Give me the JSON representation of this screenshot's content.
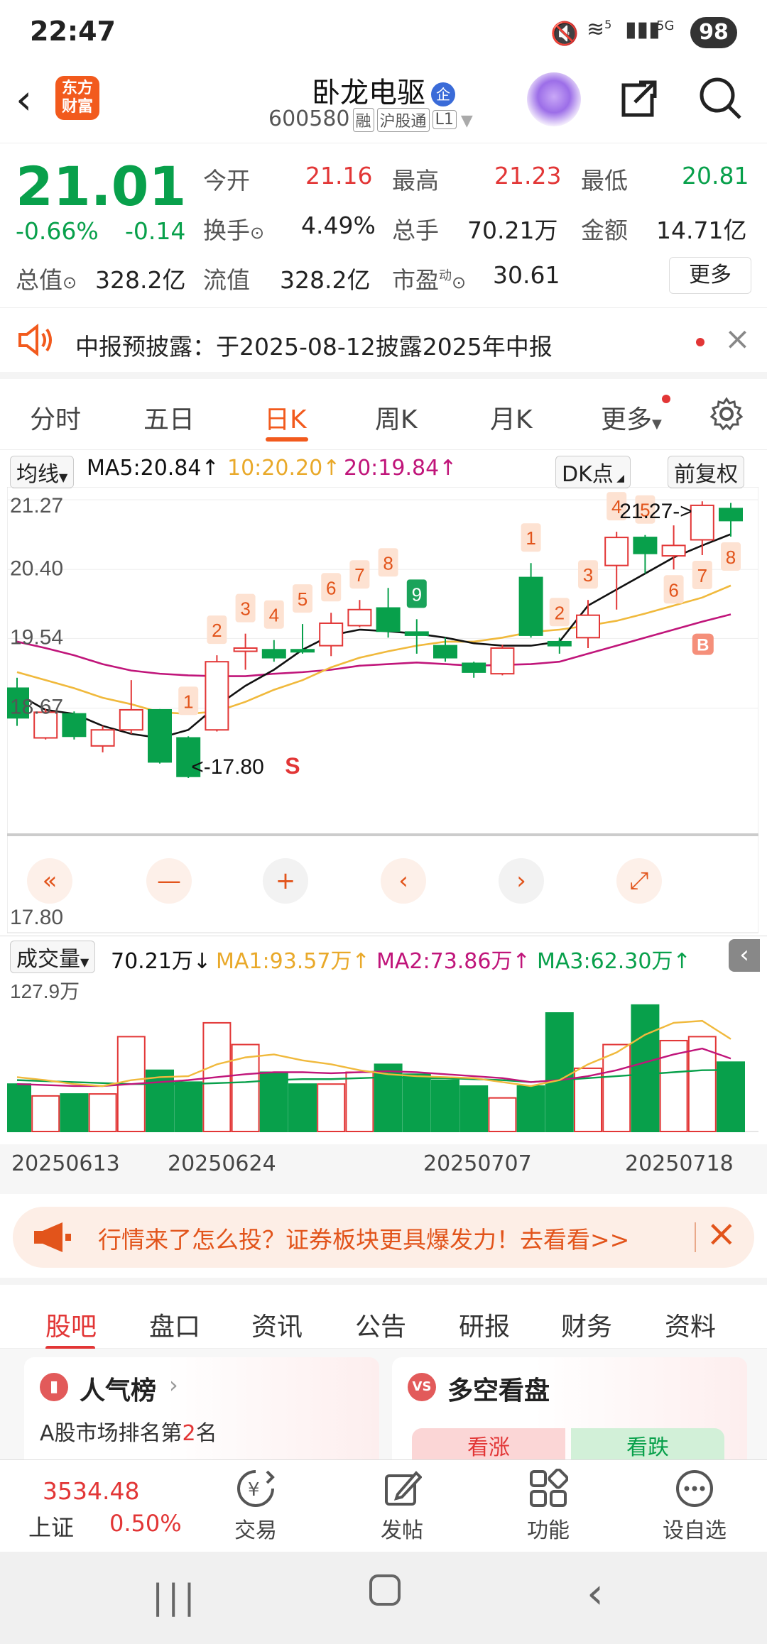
{
  "status": {
    "time": "22:47",
    "battery": "98",
    "net1": "5",
    "net2": "5G"
  },
  "header": {
    "title": "卧龙电驱",
    "badge": "企",
    "code": "600580",
    "tags": [
      "融",
      "沪股通",
      "L1"
    ],
    "logo_text": "东方\n财富"
  },
  "quote": {
    "price": "21.01",
    "change_pct": "-0.66%",
    "change": "-0.14",
    "open_label": "今开",
    "open": "21.16",
    "high_label": "最高",
    "high": "21.23",
    "low_label": "最低",
    "low": "20.81",
    "turnover_label": "换手",
    "turnover": "4.49%",
    "volume_label": "总手",
    "volume": "70.21万",
    "amount_label": "金额",
    "amount": "14.71亿",
    "mcap_label": "总值",
    "mcap": "328.2亿",
    "float_label": "流值",
    "float": "328.2亿",
    "pe_label": "市盈",
    "pe_sup": "动",
    "pe": "30.61",
    "more": "更多"
  },
  "notice": {
    "text": "中报预披露：于2025-08-12披露2025年中报"
  },
  "tabs": [
    "分时",
    "五日",
    "日K",
    "周K",
    "月K",
    "更多"
  ],
  "chart_header": {
    "ma_select": "均线",
    "ma5": "MA5:20.84↑",
    "ma10": "10:20.20↑",
    "ma20": "20:19.84↑",
    "dk": "DK点",
    "adjust": "前复权"
  },
  "chart_labels": {
    "y_top": "21.27",
    "y2": "20.40",
    "y3": "19.54",
    "y4": "18.67",
    "y_bottom": "17.80",
    "max_label": "21.27->",
    "min_label": "<-17.80",
    "sell": "S",
    "buy": "B"
  },
  "vol_header": {
    "select": "成交量",
    "vol": "70.21万↓",
    "ma1": "MA1:93.57万↑",
    "ma2": "MA2:73.86万↑",
    "ma3": "MA3:62.30万↑",
    "top": "127.9万"
  },
  "dates": [
    "20250613",
    "20250624",
    "20250707",
    "20250718"
  ],
  "banner": {
    "text": "行情来了怎么投？证券板块更具爆发力！去看看>>"
  },
  "feed_tabs": [
    "股吧",
    "盘口",
    "资讯",
    "公告",
    "研报",
    "财务",
    "资料"
  ],
  "cards": {
    "left_title": "人气榜",
    "left_sub_pre": "A股市场排名第",
    "left_sub_num": "2",
    "left_sub_post": "名",
    "right_title": "多空看盘",
    "up": "看涨",
    "down": "看跌"
  },
  "bottom_nav": {
    "index_value": "3534.48",
    "index_name": "上证",
    "index_change": "0.50%",
    "items": [
      "交易",
      "发帖",
      "功能",
      "设自选"
    ]
  },
  "colors": {
    "up": "#e23636",
    "down": "#08a04b",
    "accent": "#f25a1d",
    "ma5": "#111111",
    "ma10": "#f0b93c",
    "ma20": "#c0157a"
  },
  "chart_data": {
    "type": "candlestick",
    "ylim": [
      17.8,
      21.27
    ],
    "candles": [
      {
        "o": 18.92,
        "c": 18.55,
        "h": 19.05,
        "l": 18.45
      },
      {
        "o": 18.3,
        "c": 18.62,
        "h": 18.66,
        "l": 18.28
      },
      {
        "o": 18.6,
        "c": 18.32,
        "h": 18.63,
        "l": 18.28
      },
      {
        "o": 18.2,
        "c": 18.4,
        "h": 18.45,
        "l": 18.12
      },
      {
        "o": 18.4,
        "c": 18.65,
        "h": 19.02,
        "l": 18.35
      },
      {
        "o": 18.65,
        "c": 18.0,
        "h": 18.66,
        "l": 17.98
      },
      {
        "o": 18.3,
        "c": 17.82,
        "h": 18.32,
        "l": 17.8
      },
      {
        "o": 18.4,
        "c": 19.25,
        "h": 19.33,
        "l": 18.38
      },
      {
        "o": 19.38,
        "c": 19.42,
        "h": 19.6,
        "l": 19.15
      },
      {
        "o": 19.4,
        "c": 19.3,
        "h": 19.52,
        "l": 19.25
      },
      {
        "o": 19.4,
        "c": 19.38,
        "h": 19.72,
        "l": 19.35
      },
      {
        "o": 19.45,
        "c": 19.73,
        "h": 19.86,
        "l": 19.32
      },
      {
        "o": 19.7,
        "c": 19.9,
        "h": 20.02,
        "l": 19.68
      },
      {
        "o": 19.92,
        "c": 19.63,
        "h": 20.17,
        "l": 19.55
      },
      {
        "o": 19.62,
        "c": 19.58,
        "h": 19.78,
        "l": 19.35
      },
      {
        "o": 19.45,
        "c": 19.3,
        "h": 19.55,
        "l": 19.25
      },
      {
        "o": 19.23,
        "c": 19.12,
        "h": 19.25,
        "l": 19.05
      },
      {
        "o": 19.1,
        "c": 19.42,
        "h": 19.46,
        "l": 19.08
      },
      {
        "o": 20.3,
        "c": 19.58,
        "h": 20.48,
        "l": 19.55
      },
      {
        "o": 19.5,
        "c": 19.45,
        "h": 19.55,
        "l": 19.35
      },
      {
        "o": 19.55,
        "c": 19.83,
        "h": 20.02,
        "l": 19.42
      },
      {
        "o": 20.45,
        "c": 20.8,
        "h": 20.87,
        "l": 19.9
      },
      {
        "o": 20.8,
        "c": 20.6,
        "h": 20.83,
        "l": 20.35
      },
      {
        "o": 20.57,
        "c": 20.7,
        "h": 20.95,
        "l": 20.4
      },
      {
        "o": 20.77,
        "c": 21.2,
        "h": 21.25,
        "l": 20.58
      },
      {
        "o": 21.16,
        "c": 21.01,
        "h": 21.23,
        "l": 20.81
      }
    ],
    "ma5": [
      18.85,
      18.65,
      18.6,
      18.45,
      18.35,
      18.3,
      18.4,
      18.7,
      18.95,
      19.15,
      19.4,
      19.58,
      19.65,
      19.63,
      19.6,
      19.55,
      19.48,
      19.45,
      19.45,
      19.5,
      19.95,
      20.15,
      20.35,
      20.55,
      20.7,
      20.84
    ],
    "ma10": [
      19.12,
      19.02,
      18.92,
      18.8,
      18.72,
      18.62,
      18.6,
      18.63,
      18.75,
      18.9,
      19.02,
      19.18,
      19.3,
      19.38,
      19.45,
      19.5,
      19.5,
      19.55,
      19.62,
      19.65,
      19.7,
      19.76,
      19.85,
      19.95,
      20.05,
      20.2
    ],
    "ma20": [
      19.5,
      19.42,
      19.33,
      19.22,
      19.14,
      19.1,
      19.08,
      19.07,
      19.07,
      19.1,
      19.12,
      19.15,
      19.2,
      19.22,
      19.24,
      19.22,
      19.2,
      19.21,
      19.22,
      19.25,
      19.35,
      19.45,
      19.55,
      19.65,
      19.75,
      19.84
    ],
    "volume": [
      48,
      36,
      38,
      38,
      96,
      62,
      50,
      110,
      88,
      60,
      48,
      48,
      60,
      68,
      58,
      52,
      46,
      34,
      46,
      120,
      64,
      88,
      128,
      92,
      96,
      70.21
    ],
    "vol_ma1": [
      55,
      52,
      48,
      46,
      52,
      55,
      56,
      68,
      75,
      78,
      72,
      68,
      62,
      58,
      56,
      55,
      54,
      50,
      46,
      52,
      68,
      80,
      98,
      110,
      112,
      93.57
    ],
    "vol_ma2": [
      48,
      47,
      46,
      46,
      48,
      50,
      52,
      55,
      58,
      60,
      60,
      59,
      60,
      61,
      60,
      58,
      56,
      54,
      50,
      52,
      56,
      62,
      70,
      78,
      84,
      73.86
    ],
    "vol_ma3": [
      52,
      51,
      50,
      49,
      48,
      48,
      48,
      49,
      50,
      52,
      53,
      53,
      54,
      55,
      54,
      54,
      53,
      52,
      50,
      52,
      54,
      56,
      58,
      60,
      62,
      62.3
    ],
    "vol_ylim": [
      0,
      127.9
    ],
    "candle_numbers": [
      "1",
      "2",
      "3",
      "4",
      "5",
      "6",
      "7",
      "8",
      "9",
      "1",
      "2",
      "3",
      "4",
      "5",
      "6",
      "7",
      "8"
    ],
    "x_dates": [
      "20250613",
      "20250624",
      "20250707",
      "20250718"
    ]
  }
}
